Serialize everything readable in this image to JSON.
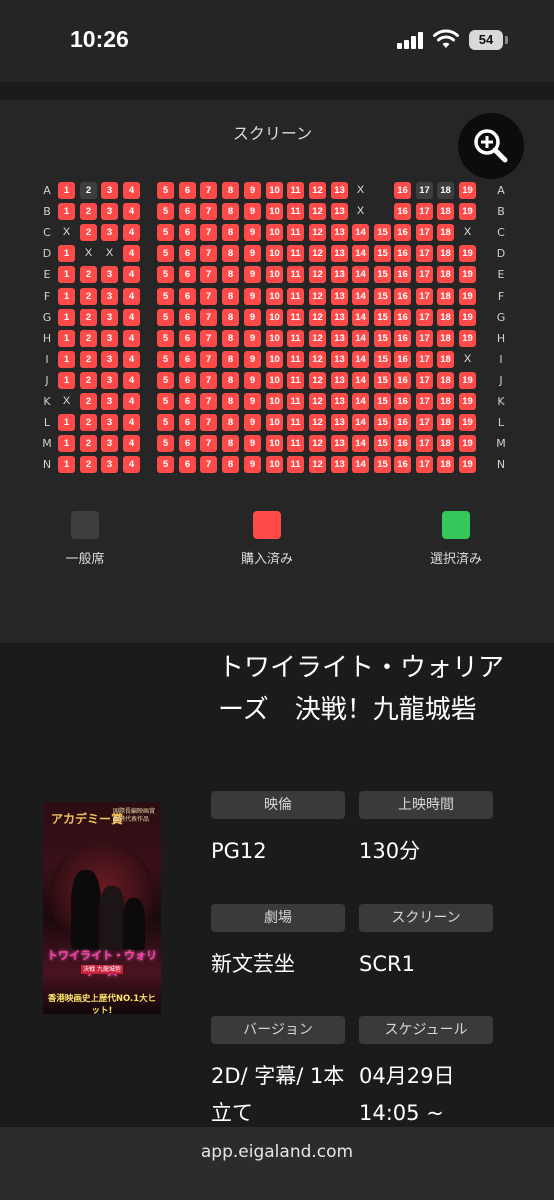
{
  "status_bar": {
    "time": "10:26",
    "battery": "54"
  },
  "seat_map": {
    "screen_label": "スクリーン",
    "zoom_icon": "zoom-in-icon",
    "blocked_mark": "X",
    "row_labels": [
      "A",
      "B",
      "C",
      "D",
      "E",
      "F",
      "G",
      "H",
      "I",
      "J",
      "K",
      "L",
      "M",
      "N"
    ],
    "rows": {
      "A": {
        "left": [
          1,
          2,
          3,
          4
        ],
        "middle": [
          5,
          6,
          7,
          8,
          9,
          10,
          11,
          12,
          13,
          "X"
        ],
        "right": [
          16,
          17,
          18,
          19
        ],
        "available": [
          2,
          17,
          18
        ]
      },
      "B": {
        "left": [
          1,
          2,
          3,
          4
        ],
        "middle": [
          5,
          6,
          7,
          8,
          9,
          10,
          11,
          12,
          13,
          "X"
        ],
        "right": [
          16,
          17,
          18,
          19
        ],
        "available": []
      },
      "C": {
        "left": [
          "X",
          2,
          3,
          4
        ],
        "middle": [
          5,
          6,
          7,
          8,
          9,
          10,
          11,
          12,
          13,
          14,
          15
        ],
        "right": [
          16,
          17,
          18,
          "X"
        ],
        "available": []
      },
      "D": {
        "left": [
          1,
          "X",
          "X",
          4
        ],
        "middle": [
          5,
          6,
          7,
          8,
          9,
          10,
          11,
          12,
          13,
          14,
          15
        ],
        "right": [
          16,
          17,
          18,
          19
        ],
        "available": []
      },
      "E": {
        "left": [
          1,
          2,
          3,
          4
        ],
        "middle": [
          5,
          6,
          7,
          8,
          9,
          10,
          11,
          12,
          13,
          14,
          15
        ],
        "right": [
          16,
          17,
          18,
          19
        ],
        "available": []
      },
      "F": {
        "left": [
          1,
          2,
          3,
          4
        ],
        "middle": [
          5,
          6,
          7,
          8,
          9,
          10,
          11,
          12,
          13,
          14,
          15
        ],
        "right": [
          16,
          17,
          18,
          19
        ],
        "available": []
      },
      "G": {
        "left": [
          1,
          2,
          3,
          4
        ],
        "middle": [
          5,
          6,
          7,
          8,
          9,
          10,
          11,
          12,
          13,
          14,
          15
        ],
        "right": [
          16,
          17,
          18,
          19
        ],
        "available": []
      },
      "H": {
        "left": [
          1,
          2,
          3,
          4
        ],
        "middle": [
          5,
          6,
          7,
          8,
          9,
          10,
          11,
          12,
          13,
          14,
          15
        ],
        "right": [
          16,
          17,
          18,
          19
        ],
        "available": []
      },
      "I": {
        "left": [
          1,
          2,
          3,
          4
        ],
        "middle": [
          5,
          6,
          7,
          8,
          9,
          10,
          11,
          12,
          13,
          14,
          15
        ],
        "right": [
          16,
          17,
          18,
          "X"
        ],
        "available": []
      },
      "J": {
        "left": [
          1,
          2,
          3,
          4
        ],
        "middle": [
          5,
          6,
          7,
          8,
          9,
          10,
          11,
          12,
          13,
          14,
          15
        ],
        "right": [
          16,
          17,
          18,
          19
        ],
        "available": []
      },
      "K": {
        "left": [
          "X",
          2,
          3,
          4
        ],
        "middle": [
          5,
          6,
          7,
          8,
          9,
          10,
          11,
          12,
          13,
          14,
          15
        ],
        "right": [
          16,
          17,
          18,
          19
        ],
        "available": []
      },
      "L": {
        "left": [
          1,
          2,
          3,
          4
        ],
        "middle": [
          5,
          6,
          7,
          8,
          9,
          10,
          11,
          12,
          13,
          14,
          15
        ],
        "right": [
          16,
          17,
          18,
          19
        ],
        "available": []
      },
      "M": {
        "left": [
          1,
          2,
          3,
          4
        ],
        "middle": [
          5,
          6,
          7,
          8,
          9,
          10,
          11,
          12,
          13,
          14,
          15
        ],
        "right": [
          16,
          17,
          18,
          19
        ],
        "available": []
      },
      "N": {
        "left": [
          1,
          2,
          3,
          4
        ],
        "middle": [
          5,
          6,
          7,
          8,
          9,
          10,
          11,
          12,
          13,
          14,
          15
        ],
        "right": [
          16,
          17,
          18,
          19
        ],
        "available": []
      }
    },
    "colors": {
      "sold": "#ff4a4a",
      "available": "#3e3e3e",
      "selected": "#34c759"
    }
  },
  "legend": {
    "general": "一般席",
    "purchased": "購入済み",
    "selected": "選択済み"
  },
  "film": {
    "title": "トワイライト・ウォリアーズ　決戦！九龍城砦",
    "poster": {
      "award": "アカデミー賞",
      "award_sub": "国際長編映画賞 香港代表作品",
      "title": "トワイライト・ウォリアーズ",
      "subtitle": "決戦 九龍城砦",
      "tagline": "香港映画史上歴代NO.1大ヒット!"
    },
    "details": {
      "rating_label": "映倫",
      "rating_value": "PG12",
      "runtime_label": "上映時間",
      "runtime_value": "130分",
      "theater_label": "劇場",
      "theater_value": "新文芸坐",
      "screen_label": "スクリーン",
      "screen_value": "SCR1",
      "version_label": "バージョン",
      "version_value": "2D/ 字幕/ 1本立て",
      "schedule_label": "スケジュール",
      "schedule_value": "04月29日14:05 ~"
    }
  },
  "browser": {
    "url": "app.eigaland.com"
  }
}
